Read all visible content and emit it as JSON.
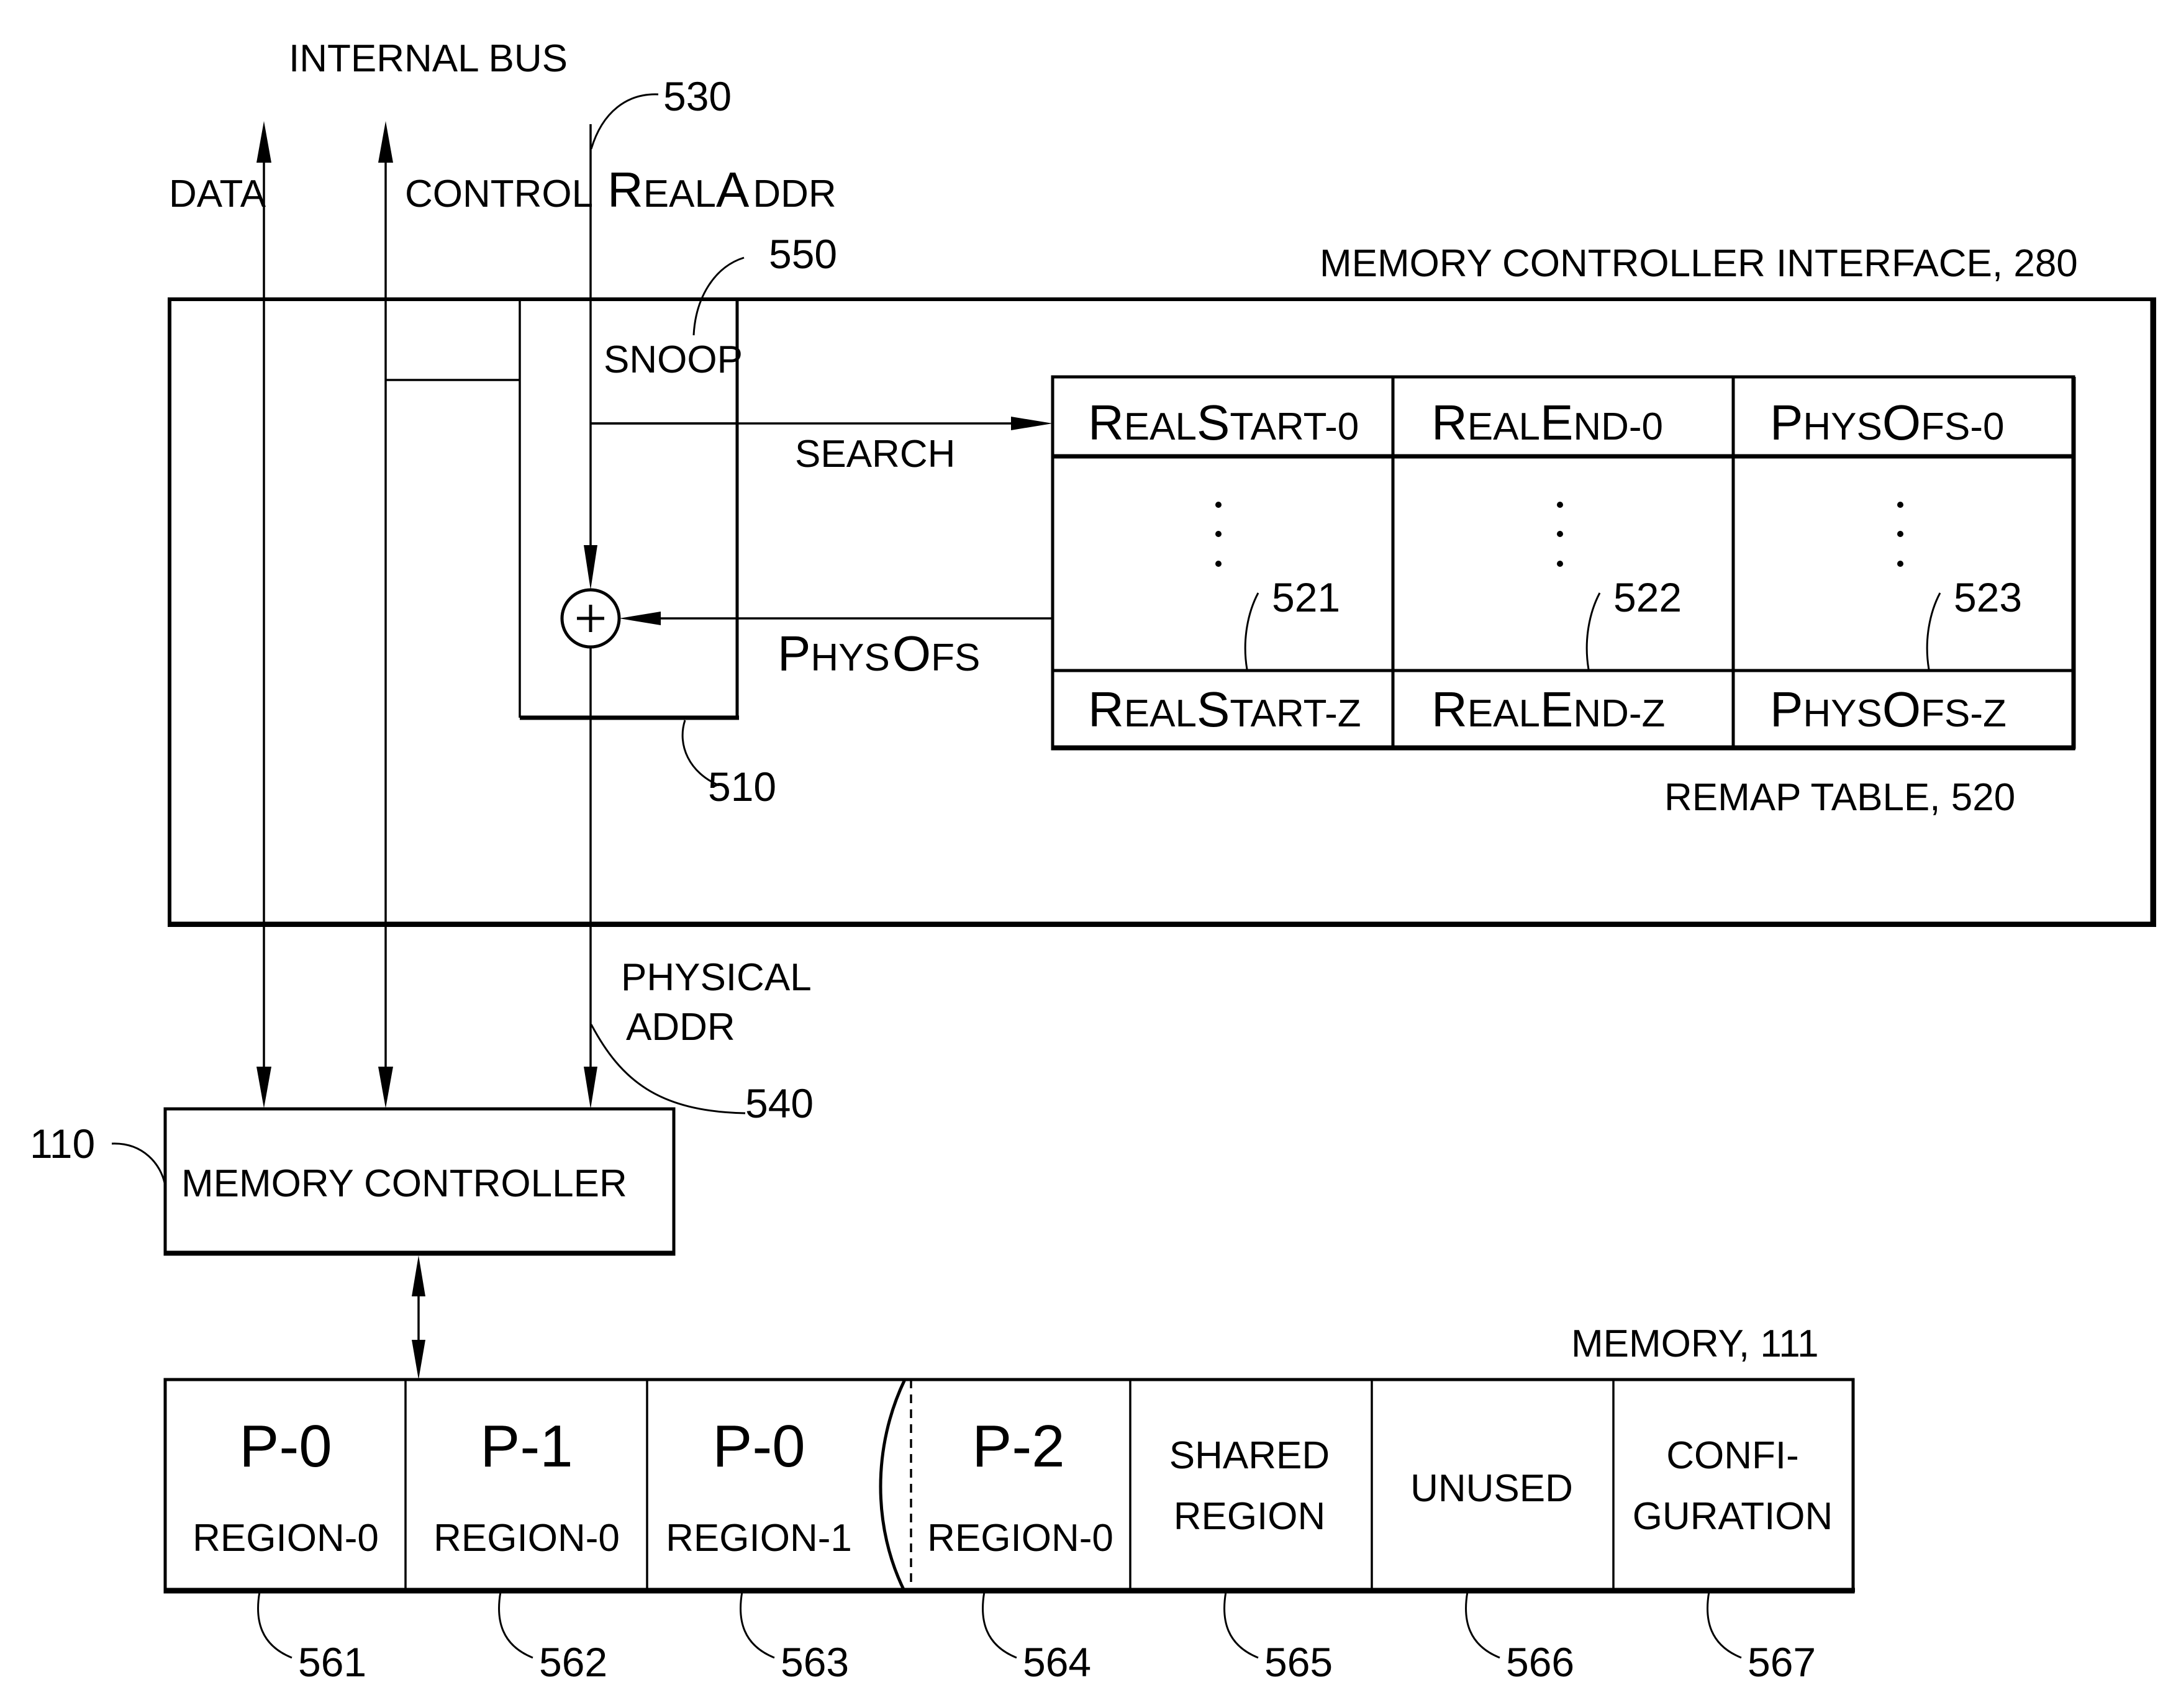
{
  "figure": {
    "internal_bus": {
      "title": "INTERNAL BUS",
      "lines": [
        {
          "label": "DATA"
        },
        {
          "label": "CONTROL"
        },
        {
          "label": "REALADDR",
          "label_small_caps": [
            "R",
            "EAL",
            "A",
            "DDR"
          ],
          "ref": "530"
        }
      ]
    },
    "interface": {
      "title": "MEMORY CONTROLLER INTERFACE, 280"
    },
    "remap_unit": {
      "ref": "510",
      "snoop": {
        "label": "SNOOP",
        "ref": "550"
      },
      "adder_symbol": "+",
      "search_label": "SEARCH",
      "physofs_label": "PHYSOFS",
      "physofs_small_caps": [
        "P",
        "HYS",
        "O",
        "FS"
      ]
    },
    "remap_table": {
      "title": "REMAP TABLE, 520",
      "columns": [
        {
          "ref": "521",
          "first": [
            "R",
            "EAL",
            "S",
            "TART",
            "-0"
          ],
          "last": [
            "R",
            "EAL",
            "S",
            "TART",
            "-Z"
          ]
        },
        {
          "ref": "522",
          "first": [
            "R",
            "EAL",
            "E",
            "ND",
            "-0"
          ],
          "last": [
            "R",
            "EAL",
            "E",
            "ND",
            "-Z"
          ]
        },
        {
          "ref": "523",
          "first": [
            "P",
            "HYS",
            "O",
            "FS",
            "-0"
          ],
          "last": [
            "P",
            "HYS",
            "O",
            "FS",
            "-Z"
          ]
        }
      ],
      "ellipsis": "⋮"
    },
    "physical_addr": {
      "line1": "PHYSICAL",
      "line2": "ADDR",
      "ref": "540"
    },
    "memory_controller": {
      "label": "MEMORY CONTROLLER",
      "ref": "110"
    },
    "memory": {
      "title": "MEMORY, 111",
      "regions": [
        {
          "line1": "P-0",
          "line2": "REGION-0",
          "ref": "561"
        },
        {
          "line1": "P-1",
          "line2": "REGION-0",
          "ref": "562"
        },
        {
          "line1": "P-0",
          "line2": "REGION-1",
          "ref": "563"
        },
        {
          "line1": "P-2",
          "line2": "REGION-0",
          "ref": "564"
        },
        {
          "line1": "SHARED",
          "line2": "REGION",
          "ref": "565"
        },
        {
          "line1": "UNUSED",
          "line2": "",
          "ref": "566"
        },
        {
          "line1": "CONFI-",
          "line2": "GURATION",
          "ref": "567"
        }
      ]
    }
  }
}
